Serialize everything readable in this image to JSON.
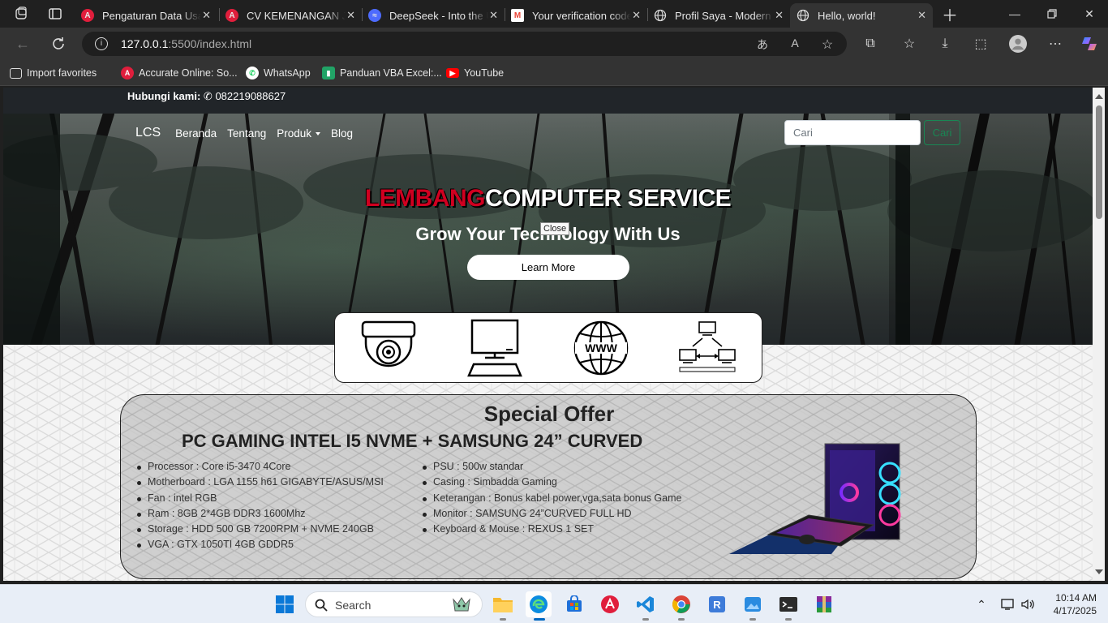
{
  "browser": {
    "tabs": [
      {
        "title": "Pengaturan Data Usaha",
        "favicon": "accurate-icon",
        "color": "#e01e3c"
      },
      {
        "title": "CV KEMENANGAN JAYA",
        "favicon": "accurate-icon",
        "color": "#e01e3c"
      },
      {
        "title": "DeepSeek - Into the Unknown",
        "favicon": "deepseek-icon",
        "color": "#4d6bfe"
      },
      {
        "title": "Your verification code",
        "favicon": "gmail-icon",
        "color": "#ea4335"
      },
      {
        "title": "Profil Saya - Modern",
        "favicon": "globe-icon",
        "color": "#cccccc"
      },
      {
        "title": "Hello, world!",
        "favicon": "globe-icon",
        "color": "#cccccc"
      }
    ],
    "url_host": "127.0.0.1",
    "url_path": ":5500/index.html",
    "favorites": [
      {
        "label": "Import favorites"
      },
      {
        "label": "Accurate Online: So..."
      },
      {
        "label": "WhatsApp"
      },
      {
        "label": "Panduan VBA Excel:..."
      },
      {
        "label": "YouTube"
      }
    ]
  },
  "page": {
    "contact_label": "Hubungi kami:",
    "contact_phone": "082219088627",
    "nav": {
      "brand": "LCS",
      "links": [
        "Beranda",
        "Tentang",
        "Produk",
        "Blog"
      ],
      "search_placeholder": "Cari",
      "search_button": "Cari"
    },
    "hero": {
      "title_red": "LEMBANG",
      "title_white": "COMPUTER SERVICE",
      "subtitle": "Grow Your Technology With Us",
      "tooltip": "Close",
      "button": "Learn More"
    },
    "services": [
      "cctv-icon",
      "computer-icon",
      "www-icon",
      "network-icon"
    ],
    "offer": {
      "title": "Special Offer",
      "product": "PC GAMING INTEL I5 NVME + SAMSUNG 24” CURVED",
      "specs_left": [
        "Processor : Core i5-3470 4Core",
        "Motherboard : LGA 1155 h61 GIGABYTE/ASUS/MSI",
        "Fan : intel RGB",
        "Ram : 8GB 2*4GB DDR3 1600Mhz",
        "Storage : HDD 500 GB 7200RPM + NVME 240GB",
        "VGA : GTX 1050TI 4GB GDDR5"
      ],
      "specs_right": [
        "PSU : 500w standar",
        "Casing : Simbadda Gaming",
        "Keterangan : Bonus kabel power,vga,sata bonus Game",
        "Monitor : SAMSUNG 24”CURVED FULL HD",
        "Keyboard & Mouse : REXUS 1 SET"
      ]
    }
  },
  "taskbar": {
    "search_label": "Search",
    "time": "10:14 AM",
    "date": "4/17/2025"
  }
}
